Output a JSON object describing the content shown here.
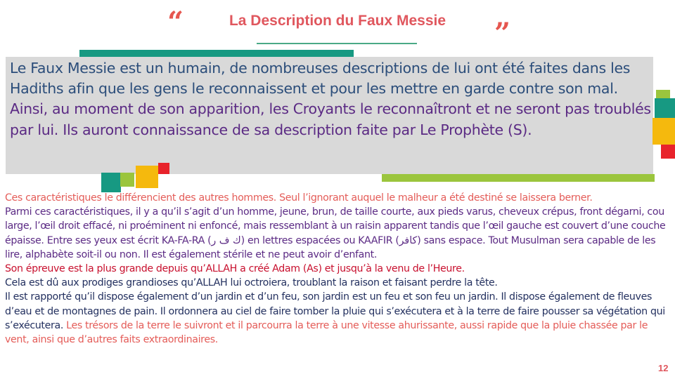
{
  "slide": {
    "title": "La Description du Faux Messie",
    "open_quote": "“",
    "close_quote": "”",
    "page_number": "12"
  },
  "box": {
    "p1": "Le Faux Messie est un humain, de nombreuses descriptions de lui ont été faites dans les Hadiths afin que les gens le reconnaissent et pour les mettre en garde contre son mal.",
    "p2": "Ainsi, au moment de son apparition, les Croyants le reconnaîtront et ne seront pas troublés par lui. Ils auront connaissance de sa description faite par Le Prophète (S)."
  },
  "body": {
    "p1": "Ces caractéristiques le différencient des autres hommes. Seul l’ignorant auquel le malheur a été destiné se laissera berner.",
    "p2_a": "Parmi ces caractéristiques, il y a qu’il s’agit d’un homme, jeune, brun, de taille courte, aux pieds varus, cheveux crépus, front dégarni, cou large, l’œil droit effacé, ni proéminent ni enfoncé, mais ressemblant à un raisin apparent tandis que l’œil gauche est couvert d’une couche épaisse. Entre ses yeux est écrit KA-FA-RA (",
    "p2_arabic1": "ك ف ر",
    "p2_b": ") en lettres espacées ou KAAFIR (",
    "p2_arabic2": "كافر",
    "p2_c": ") sans espace. Tout Musulman sera capable de les lire, alphabète soit-il ou non. Il est également stérile et ne peut avoir d’enfant.",
    "p3": "Son épreuve est la plus grande depuis qu’ALLAH a créé Adam (As) et jusqu’à la venu de l’Heure.",
    "p4": "Cela est dû aux prodiges grandioses qu’ALLAH lui octroiera, troublant la raison et faisant perdre la tête.",
    "p5": "Il est rapporté qu’il dispose également d’un jardin et d’un feu, son jardin est un feu et son feu un jardin. Il dispose également de fleuves d’eau et de montagnes de pain. Il ordonnera au ciel de faire tomber la pluie qui s’exécutera et à la terre de faire pousser sa végétation qui s’exécutera.",
    "p5_red": " Les trésors de la terre le suivront et il parcourra la terre à une vitesse ahurissante, aussi rapide que la pluie chassée par le vent, ainsi que d’autres faits extraordinaires."
  },
  "colors": {
    "accent_red": "#e0575e",
    "teal": "#179982",
    "green": "#9bc53d",
    "orange": "#f5b90d",
    "red_square": "#e8232b",
    "navy_text": "#2b4d7a",
    "purple_text": "#5b2a84"
  }
}
